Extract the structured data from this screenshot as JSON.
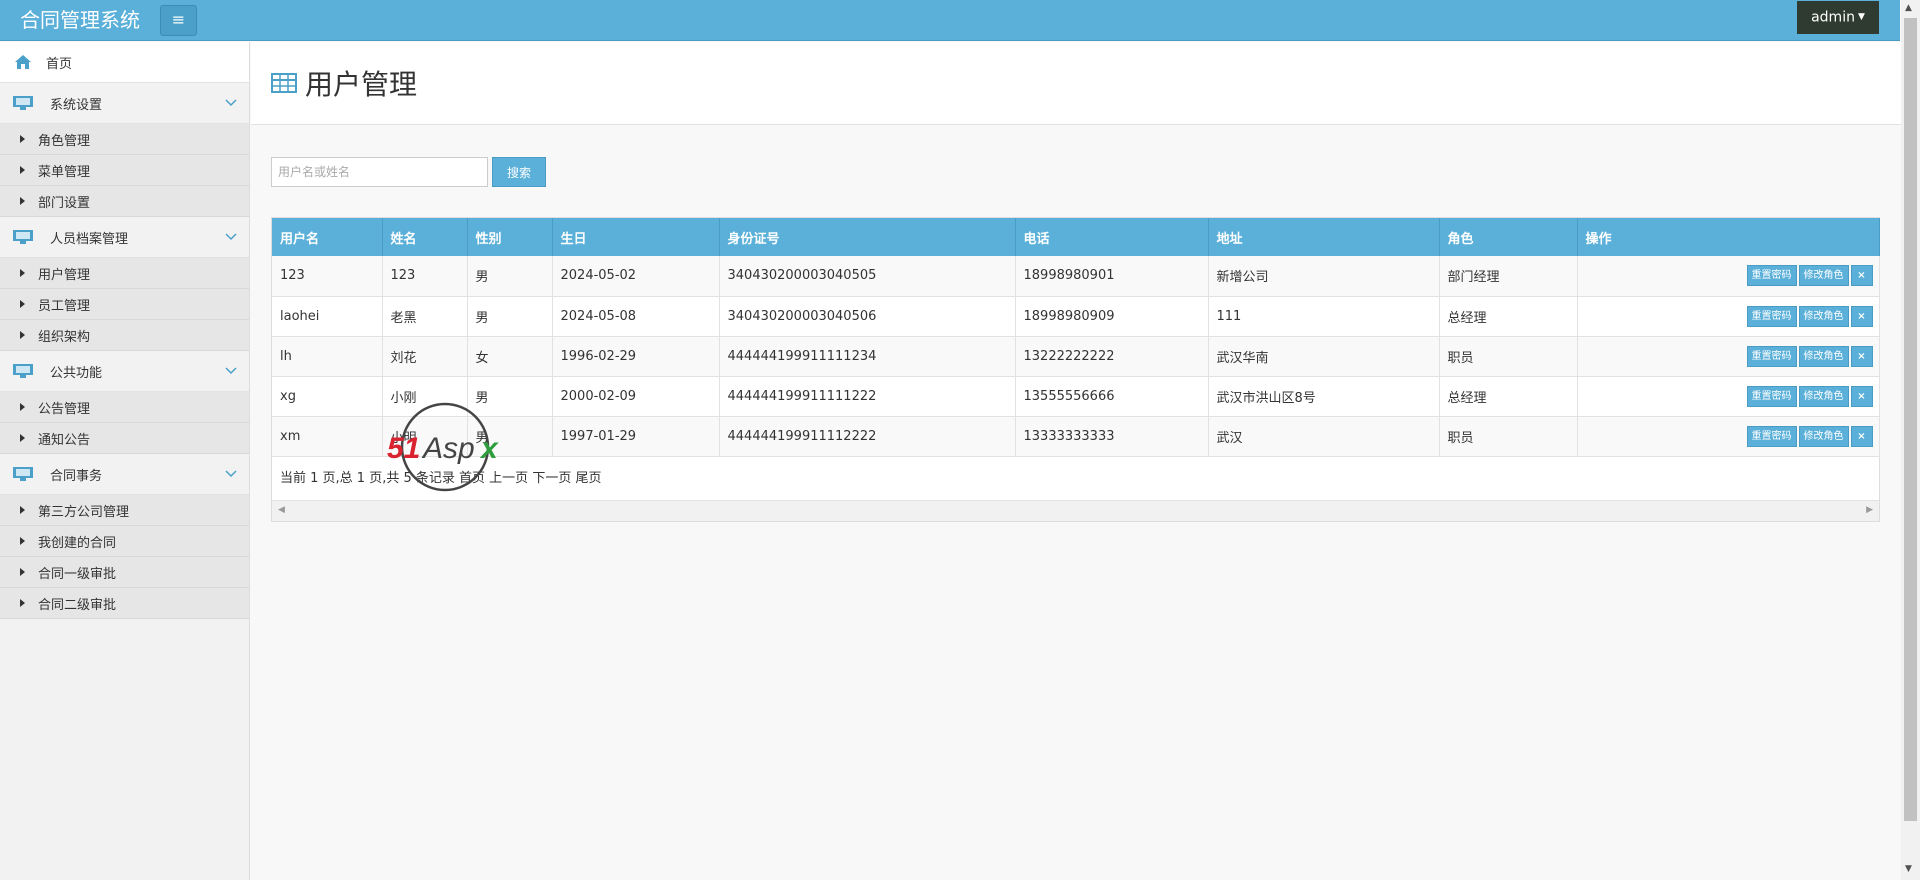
{
  "app": {
    "title": "合同管理系统",
    "menu_toggle": "≡",
    "user": "admin"
  },
  "sidebar": {
    "home": "首页",
    "groups": [
      {
        "label": "系统设置",
        "items": [
          "角色管理",
          "菜单管理",
          "部门设置"
        ]
      },
      {
        "label": "人员档案管理",
        "items": [
          "用户管理",
          "员工管理",
          "组织架构"
        ]
      },
      {
        "label": "公共功能",
        "items": [
          "公告管理",
          "通知公告"
        ]
      },
      {
        "label": "合同事务",
        "items": [
          "第三方公司管理",
          "我创建的合同",
          "合同一级审批",
          "合同二级审批"
        ]
      }
    ]
  },
  "page": {
    "title": "用户管理"
  },
  "search": {
    "placeholder": "用户名或姓名",
    "button": "搜索"
  },
  "table": {
    "columns": [
      "用户名",
      "姓名",
      "性别",
      "生日",
      "身份证号",
      "电话",
      "地址",
      "角色",
      "操作"
    ],
    "rows": [
      [
        "123",
        "123",
        "男",
        "2024-05-02",
        "340430200003040505",
        "18998980901",
        "新增公司",
        "部门经理"
      ],
      [
        "laohei",
        "老黑",
        "男",
        "2024-05-08",
        "340430200003040506",
        "18998980909",
        "111",
        "总经理"
      ],
      [
        "lh",
        "刘花",
        "女",
        "1996-02-29",
        "444444199911111234",
        "13222222222",
        "武汉华南",
        "职员"
      ],
      [
        "xg",
        "小刚",
        "男",
        "2000-02-09",
        "444444199911111222",
        "13555556666",
        "武汉市洪山区8号",
        "总经理"
      ],
      [
        "xm",
        "小明",
        "男",
        "1997-01-29",
        "444444199911112222",
        "13333333333",
        "武汉",
        "职员"
      ]
    ],
    "actions": {
      "reset_password": "重置密码",
      "change_role": "修改角色",
      "delete": "×"
    }
  },
  "pager": {
    "info": "当前 1 页,总 1 页,共 5 条记录",
    "first": "首页",
    "prev": "上一页",
    "next": "下一页",
    "last": "尾页"
  },
  "watermark": {
    "text": "51Aspx"
  },
  "colors": {
    "accent": "#5bb0d9",
    "user_menu_bg": "#2f3b30",
    "watermark_red": "#d9232e",
    "watermark_green": "#2e9e3d"
  }
}
